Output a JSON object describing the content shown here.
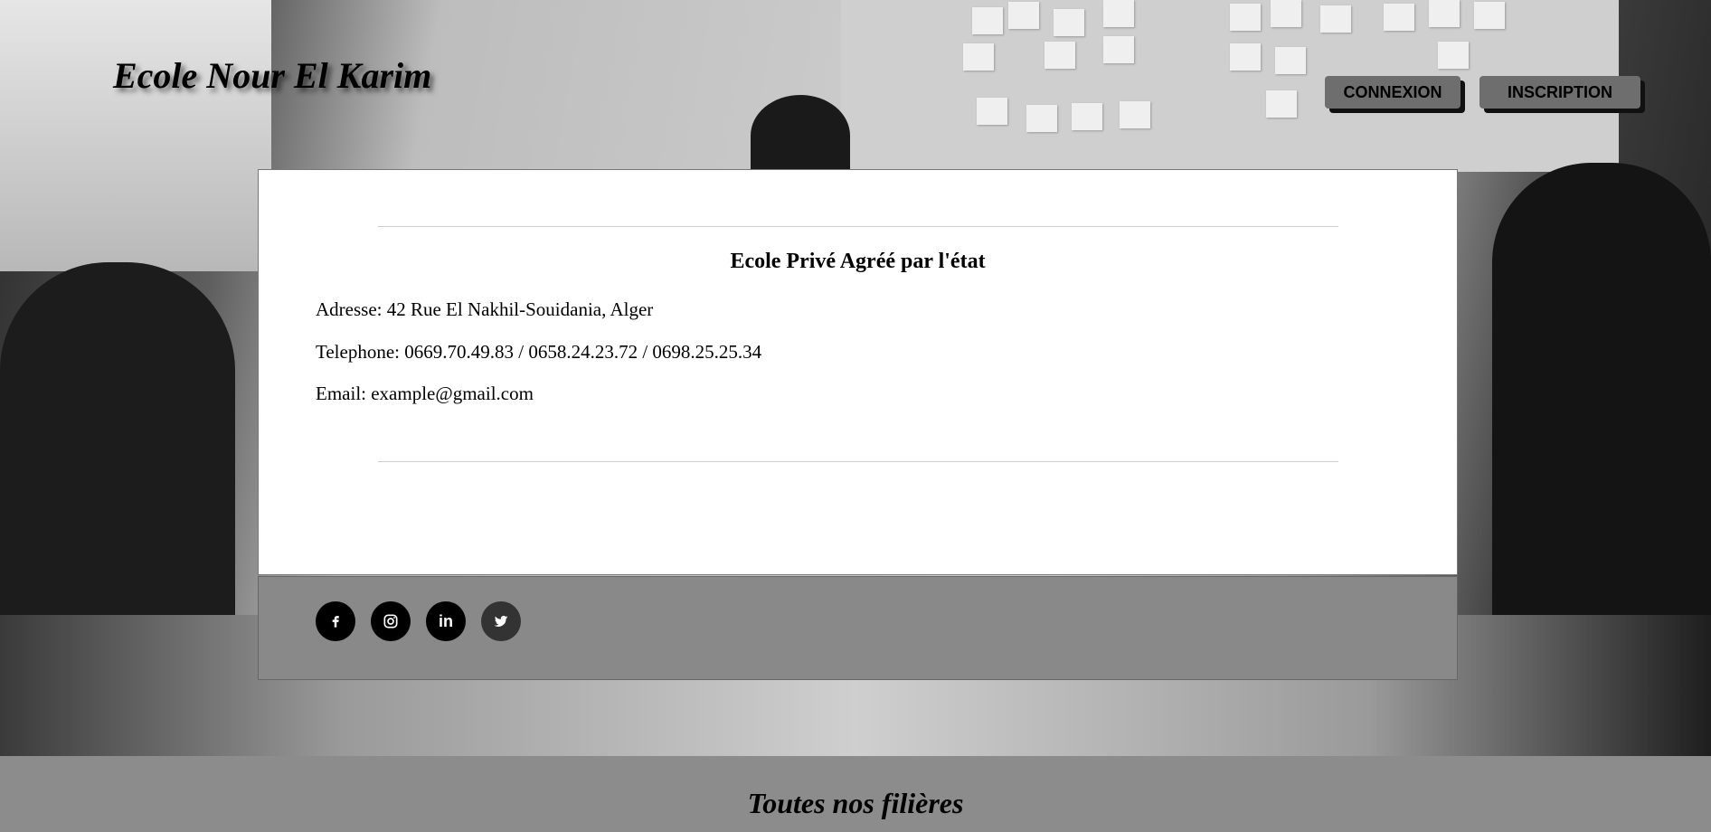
{
  "header": {
    "brand": "Ecole Nour El Karim",
    "buttons": {
      "connexion": "CONNEXION",
      "inscription": "INSCRIPTION"
    }
  },
  "contact_card": {
    "title": "Ecole Privé Agréé par l'état",
    "address": "Adresse: 42 Rue El Nakhil-Souidania, Alger",
    "phone": "Telephone: 0669.70.49.83 / 0658.24.23.72 / 0698.25.25.34",
    "email": "Email: example@gmail.com"
  },
  "social_links": [
    {
      "icon": "facebook-icon"
    },
    {
      "icon": "instagram-icon"
    },
    {
      "icon": "linkedin-icon",
      "text": "in"
    },
    {
      "icon": "twitter-icon"
    }
  ],
  "section": {
    "title": "Toutes nos filières"
  },
  "colors": {
    "card_background": "#ffffff",
    "footer_bar": "#898989",
    "button_background": "#6e6e6e",
    "social_icon_background": "#000000"
  }
}
